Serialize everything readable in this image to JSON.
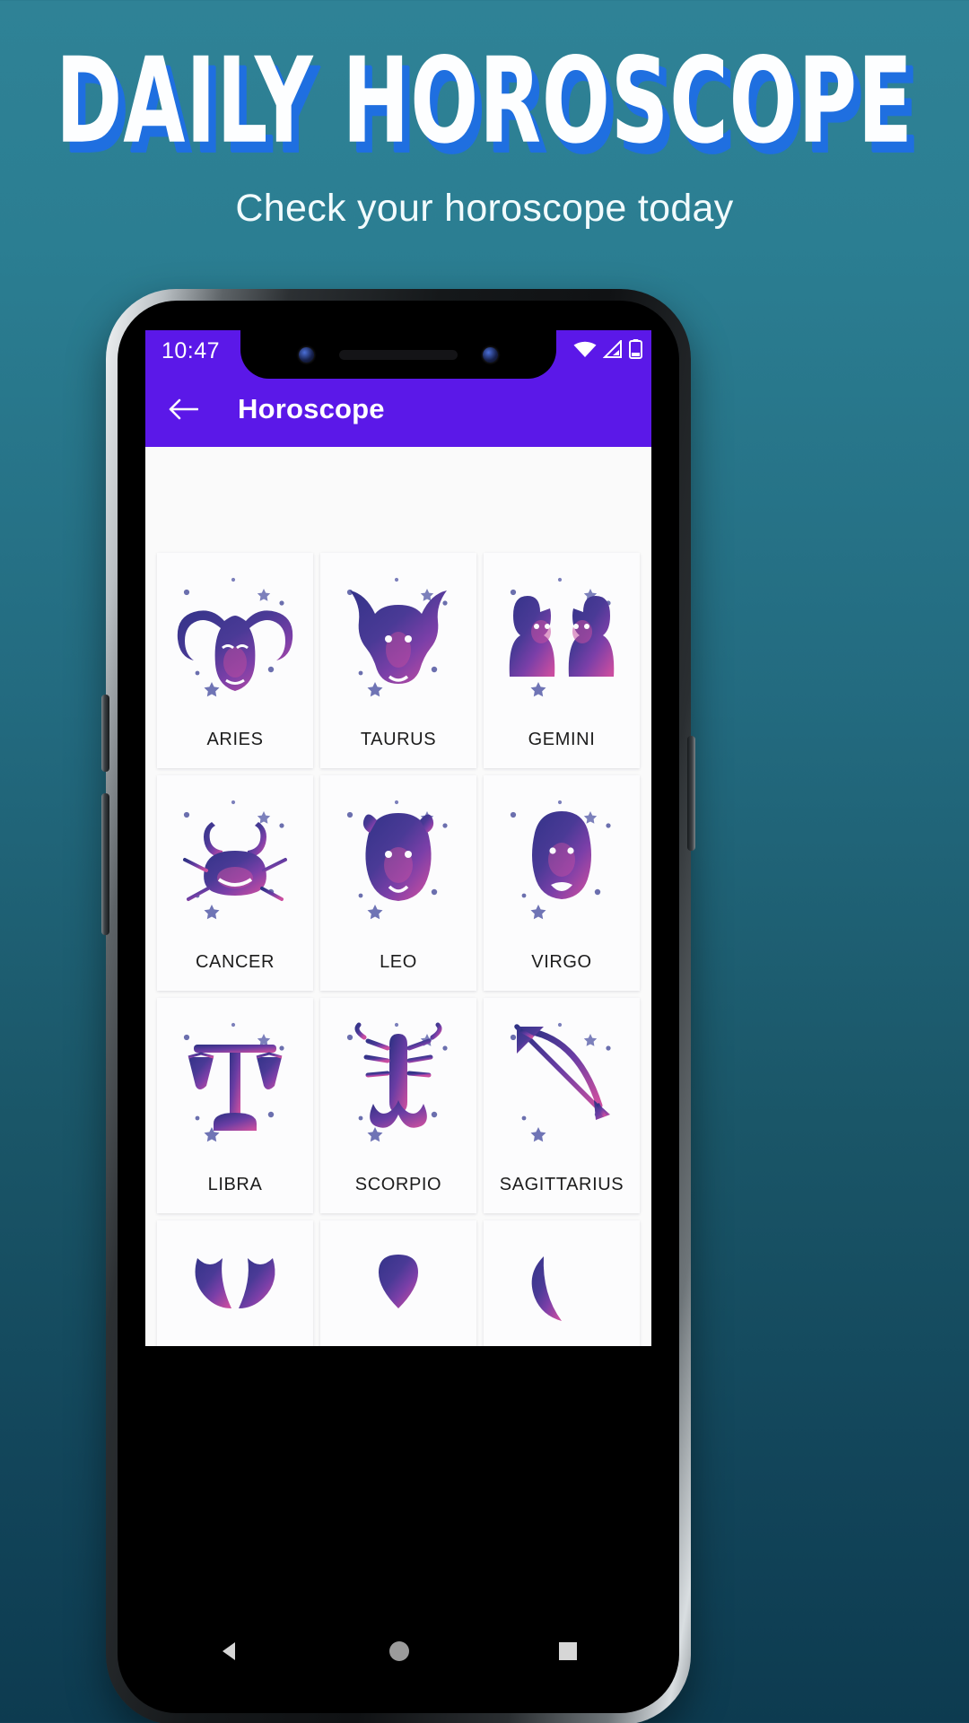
{
  "promo": {
    "title": "DAILY HOROSCOPE",
    "subtitle": "Check your horoscope today",
    "title_color": "#fdfeff",
    "title_shadow_color": "#1f6fe0",
    "background_gradient": [
      "#2f8296",
      "#0d3b50"
    ]
  },
  "phone": {
    "status_bar": {
      "time": "10:47",
      "background": "#5B18E8",
      "icons": [
        "wifi-icon",
        "cellular-signal-icon",
        "battery-icon"
      ]
    },
    "app_bar": {
      "back_label": "back-arrow",
      "title": "Horoscope",
      "background": "#5B18E8",
      "text_color": "#ffffff"
    },
    "navigation_bar": {
      "background": "#000000",
      "buttons": [
        "back-triangle-icon",
        "home-circle-icon",
        "recents-square-icon"
      ]
    }
  },
  "main": {
    "background": "#fafafa",
    "card_background": "#fcfcfd",
    "label_color": "#1c1c1c",
    "icon_gradient": [
      "#3a3a8f",
      "#6b3fa8",
      "#c94da0"
    ],
    "signs": [
      {
        "label": "ARIES",
        "icon": "aries-ram-icon"
      },
      {
        "label": "TAURUS",
        "icon": "taurus-bull-icon"
      },
      {
        "label": "GEMINI",
        "icon": "gemini-twins-icon"
      },
      {
        "label": "CANCER",
        "icon": "cancer-crab-icon"
      },
      {
        "label": "LEO",
        "icon": "leo-lion-icon"
      },
      {
        "label": "VIRGO",
        "icon": "virgo-maiden-icon"
      },
      {
        "label": "LIBRA",
        "icon": "libra-scales-icon"
      },
      {
        "label": "SCORPIO",
        "icon": "scorpio-scorpion-icon"
      },
      {
        "label": "SAGITTARIUS",
        "icon": "sagittarius-bow-icon"
      },
      {
        "label": "",
        "icon": "capricorn-goat-icon"
      },
      {
        "label": "",
        "icon": "aquarius-water-icon"
      },
      {
        "label": "",
        "icon": "pisces-fish-icon"
      }
    ]
  }
}
